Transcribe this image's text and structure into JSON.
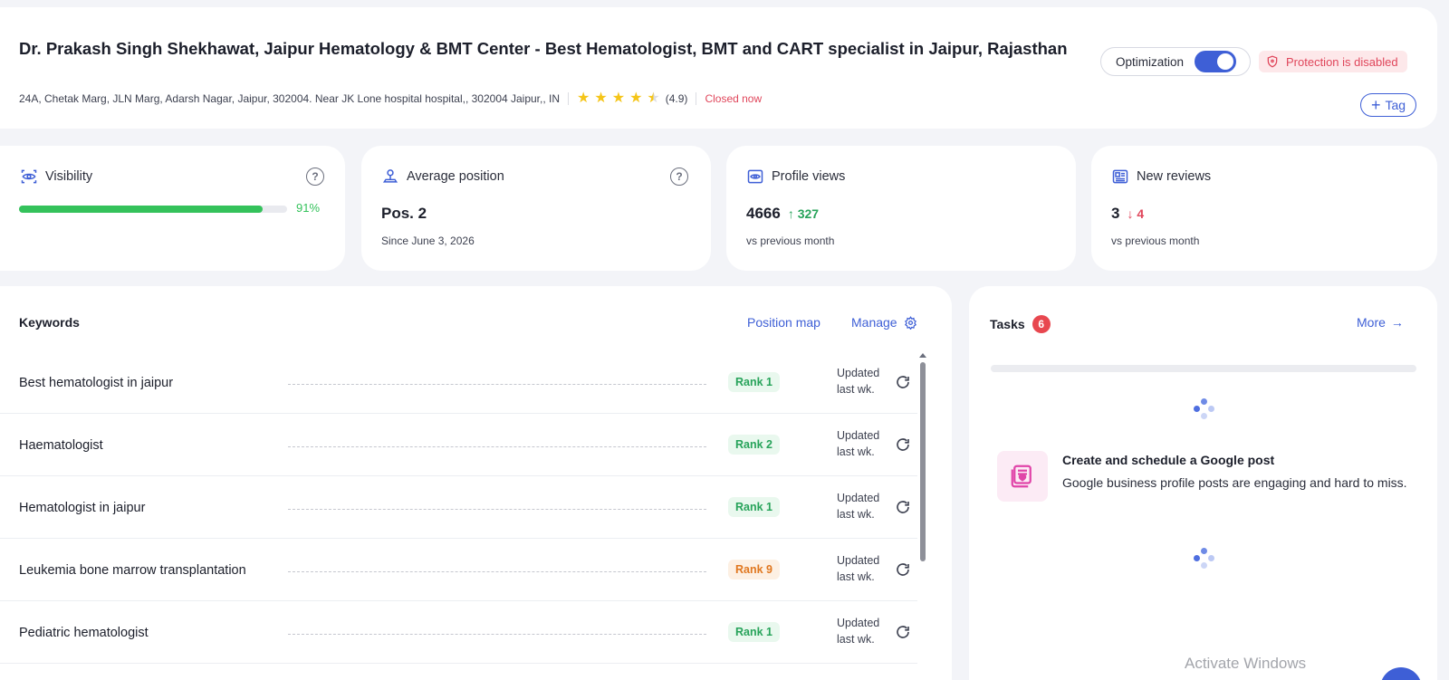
{
  "header": {
    "title": "Dr. Prakash Singh Shekhawat, Jaipur Hematology & BMT Center - Best Hematologist, BMT and CART specialist in Jaipur, Rajasthan",
    "address": "24A, Chetak Marg, JLN Marg, Adarsh Nagar, Jaipur, 302004. Near JK Lone hospital hospital,, 302004 Jaipur,, IN",
    "rating": "(4.9)",
    "rating_value": 4.5,
    "status": "Closed now",
    "optimization_label": "Optimization",
    "optimization_on": true,
    "protection_label": "Protection is disabled",
    "tag_label": "Tag"
  },
  "stats": {
    "visibility": {
      "label": "Visibility",
      "percent_label": "91%",
      "percent": 0.91
    },
    "average_position": {
      "label": "Average position",
      "value": "Pos. 2",
      "sub": "Since June 3, 2026"
    },
    "profile_views": {
      "label": "Profile views",
      "value": "4666",
      "delta": "327",
      "sub": "vs previous month"
    },
    "new_reviews": {
      "label": "New reviews",
      "value": "3",
      "delta": "4",
      "sub": "vs previous month"
    }
  },
  "keywords": {
    "title": "Keywords",
    "position_map_label": "Position map",
    "manage_label": "Manage",
    "rows": [
      {
        "name": "Best hematologist in jaipur",
        "rank": "Rank 1",
        "status": "good",
        "updated": "Updated",
        "when": "last wk."
      },
      {
        "name": "Haematologist",
        "rank": "Rank 2",
        "status": "good",
        "updated": "Updated",
        "when": "last wk."
      },
      {
        "name": "Hematologist in jaipur",
        "rank": "Rank 1",
        "status": "good",
        "updated": "Updated",
        "when": "last wk."
      },
      {
        "name": "Leukemia bone marrow transplantation",
        "rank": "Rank 9",
        "status": "warn",
        "updated": "Updated",
        "when": "last wk."
      },
      {
        "name": "Pediatric hematologist",
        "rank": "Rank 1",
        "status": "good",
        "updated": "Updated",
        "when": "last wk."
      }
    ]
  },
  "tasks": {
    "title": "Tasks",
    "count": "6",
    "more_label": "More",
    "item_title": "Create and schedule a Google post",
    "item_desc": "Google business profile posts are engaging and hard to miss."
  },
  "os": {
    "watermark": "Activate Windows"
  },
  "colors": {
    "accent": "#3e5fd6",
    "success": "#27a35a",
    "danger": "#e0465b",
    "warning": "#e0771f"
  }
}
